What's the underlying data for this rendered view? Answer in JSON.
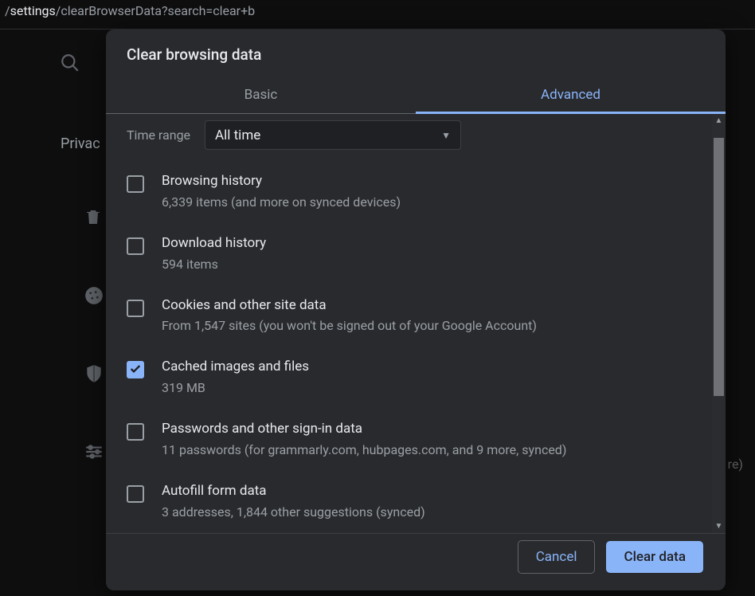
{
  "address": {
    "prefix": "/",
    "path1": "settings",
    "path2": "/clearBrowserData?search=clear+b"
  },
  "background": {
    "heading": "Privac",
    "right_text": "re)"
  },
  "dialog": {
    "title": "Clear browsing data",
    "tabs": {
      "basic": "Basic",
      "advanced": "Advanced",
      "active": "advanced"
    },
    "time_range": {
      "label": "Time range",
      "value": "All time"
    },
    "items": [
      {
        "title": "Browsing history",
        "sub": "6,339 items (and more on synced devices)",
        "checked": false
      },
      {
        "title": "Download history",
        "sub": "594 items",
        "checked": false
      },
      {
        "title": "Cookies and other site data",
        "sub": "From 1,547 sites (you won't be signed out of your Google Account)",
        "checked": false
      },
      {
        "title": "Cached images and files",
        "sub": "319 MB",
        "checked": true
      },
      {
        "title": "Passwords and other sign-in data",
        "sub": "11 passwords (for grammarly.com, hubpages.com, and 9 more, synced)",
        "checked": false
      },
      {
        "title": "Autofill form data",
        "sub": "3 addresses, 1,844 other suggestions (synced)",
        "checked": false
      }
    ],
    "buttons": {
      "cancel": "Cancel",
      "clear": "Clear data"
    }
  }
}
